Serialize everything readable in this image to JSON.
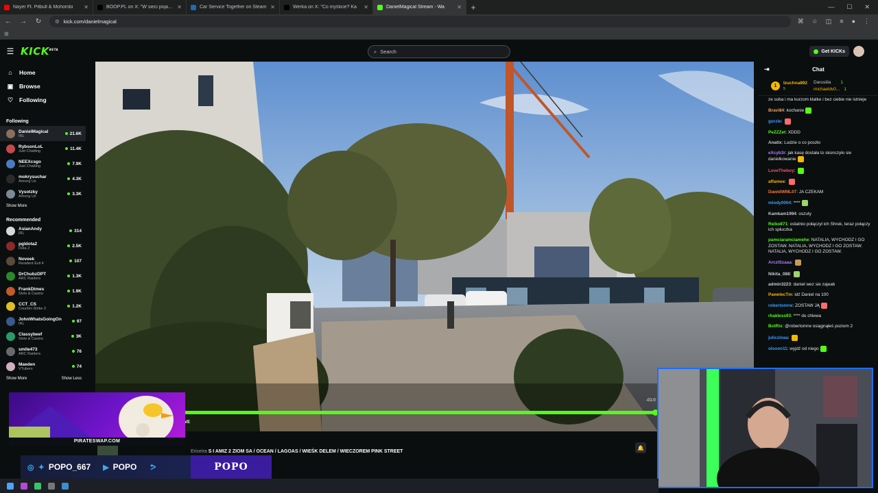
{
  "browser": {
    "tabs": [
      {
        "title": "Nayer Ft. Pitbull & Mohombi",
        "color": "#ff0000",
        "active": false
      },
      {
        "title": "BOOP.PL on X: \"W sieci pojawiło",
        "color": "#000000",
        "active": false
      },
      {
        "title": "Car Service Together on Steam",
        "color": "#1b6bb0",
        "active": false
      },
      {
        "title": "Werka on X: \"Co myślicie? Ka",
        "color": "#000000",
        "active": false
      },
      {
        "title": "DanielMagical Stream - Wa",
        "color": "#53fc18",
        "active": true
      }
    ],
    "url": "kick.com/danielmagical"
  },
  "header": {
    "logo": "KICK",
    "logo_beta": "BETA",
    "search_placeholder": "Search",
    "get_kicks": "Get KICKs"
  },
  "sidebar": {
    "nav": [
      {
        "label": "Home",
        "icon": "home-icon",
        "glyph": "⌂"
      },
      {
        "label": "Browse",
        "icon": "browse-icon",
        "glyph": "▣"
      },
      {
        "label": "Following",
        "icon": "heart-icon",
        "glyph": "♡"
      }
    ],
    "following_title": "Following",
    "following": [
      {
        "name": "DanielMagical",
        "category": "IRL",
        "viewers": "21.6K",
        "color": "#8a6f5c"
      },
      {
        "name": "RybsonLoL",
        "category": "Just Chatting",
        "viewers": "11.4K",
        "color": "#c24a4a"
      },
      {
        "name": "NEEXcsgo",
        "category": "Just Chatting",
        "viewers": "7.9K",
        "color": "#4a7bc2"
      },
      {
        "name": "mokrysuchar",
        "category": "Among Us",
        "viewers": "4.3K",
        "color": "#2a2a2a"
      },
      {
        "name": "Vysotzky",
        "category": "Among Us",
        "viewers": "3.3K",
        "color": "#7c8a96"
      }
    ],
    "show_more_1": "Show More",
    "recommended_title": "Recommended",
    "recommended": [
      {
        "name": "AsianAndy",
        "category": "IRL",
        "viewers": "314",
        "color": "#d8d8d8"
      },
      {
        "name": "pgldota2",
        "category": "Dota 2",
        "viewers": "2.5K",
        "color": "#8a2a2a"
      },
      {
        "name": "Noveek",
        "category": "Resident Evil 4",
        "viewers": "107",
        "color": "#5a4a3a"
      },
      {
        "name": "DrChubzDPT",
        "category": "ARC Raiders",
        "viewers": "1.3K",
        "color": "#2a8a2a"
      },
      {
        "name": "FrankDimes",
        "category": "Slots & Casino",
        "viewers": "1.9K",
        "color": "#c25a2a"
      },
      {
        "name": "CCT_CS",
        "category": "Counter-Strike 2",
        "viewers": "1.2K",
        "color": "#e0c020"
      },
      {
        "name": "JohnWhatsGoingOn",
        "category": "IRL",
        "viewers": "97",
        "color": "#3a5a8a"
      },
      {
        "name": "Classybeef",
        "category": "Slots & Casino",
        "viewers": "3K",
        "color": "#2a9a6a"
      },
      {
        "name": "smile473",
        "category": "ARC Raiders",
        "viewers": "76",
        "color": "#6a6a6a"
      },
      {
        "name": "Maeden",
        "category": "VTubers",
        "viewers": "74",
        "color": "#d0b0c0"
      }
    ],
    "show_more_2": "Show More",
    "show_less": "Show Less"
  },
  "player": {
    "progress": 1.0,
    "time": "-01:0",
    "live_fragment": "VE"
  },
  "stream": {
    "title_prefix": "Ericeira",
    "title": "S I AMIZ 2 ZIOM SA / OCEAN / LAGOAS / WIEŚK DELEM / WIECZOREM PINK STREET"
  },
  "overlay": {
    "ad_label": "PIRATESWAP.COM",
    "social_1": "POPO_667",
    "social_2": "POPO",
    "sign": "POPO"
  },
  "chat": {
    "title": "Chat",
    "pinned": {
      "rank": "1",
      "leader": "Izuchna892",
      "leader_count": "5",
      "side_1": "Darusiila",
      "side_1_count": "1",
      "side_2": "michaeldv0...",
      "side_2_count": "1"
    },
    "messages": [
      {
        "user": "",
        "color": "#e6e8ea",
        "text": "ze soba i ma kurzom klatke i bez ciebie nie istnieje"
      },
      {
        "user": "Bravi84",
        "color": "#f0a35c",
        "text": "kochanie"
      },
      {
        "user": "gorzle",
        "color": "#3aa0ff",
        "text": ""
      },
      {
        "user": "PeZZZet",
        "color": "#53fc18",
        "text": "XDDD"
      },
      {
        "user": "Anatix",
        "color": "#c9ccd1",
        "text": "Ludzie o co poszło"
      },
      {
        "user": "eXcyb3r",
        "color": "#b07cff",
        "text": "jak kasę dostała to skonczyło sie danielkowanie"
      },
      {
        "user": "LoveTheboy",
        "color": "#ff4d6d",
        "text": ""
      },
      {
        "user": "affamee",
        "color": "#f5b700",
        "text": ""
      },
      {
        "user": "DawidWML07",
        "color": "#f07c3a",
        "text": "JA CZEKAM"
      },
      {
        "user": "miody0004",
        "color": "#3aa0ff",
        "text": "****"
      },
      {
        "user": "Kamkam1994",
        "color": "#c9ccd1",
        "text": "oszuty"
      },
      {
        "user": "Reiko871",
        "color": "#53fc18",
        "text": "ostatnio połączył ich Shrek, teraz połączy ich spłuczka"
      },
      {
        "user": "pamciaramciamehe",
        "color": "#53fc18",
        "text": "NATALIA, WYCHODZ I GO ZOSTAW. NATALIA, WYCHODZ I GO ZOSTAW. NATALIA, WYCHODZ I GO ZOSTAW."
      },
      {
        "user": "ArczISzaaa",
        "color": "#b07cff",
        "text": ""
      },
      {
        "user": "Nikita_088",
        "color": "#c9ccd1",
        "text": ""
      },
      {
        "user": "admin3223",
        "color": "#c9ccd1",
        "text": "daniel wez sie zajeab"
      },
      {
        "user": "PawelecTm",
        "color": "#f5b700",
        "text": "idź Daniel na 100"
      },
      {
        "user": "robertomrw",
        "color": "#3aa0ff",
        "text": "ZOSTAW JĄ"
      },
      {
        "user": "rhakless93",
        "color": "#53fc18",
        "text": "**** do chlewa"
      },
      {
        "user": "BotRix",
        "color": "#53fc18",
        "text": "@robertomrw osiągnąłeś poziom 2"
      },
      {
        "user": "juliczinaa",
        "color": "#3aa0ff",
        "text": ""
      },
      {
        "user": "olsoon11",
        "color": "#3aa0ff",
        "text": "wyjdź od niego"
      }
    ]
  }
}
